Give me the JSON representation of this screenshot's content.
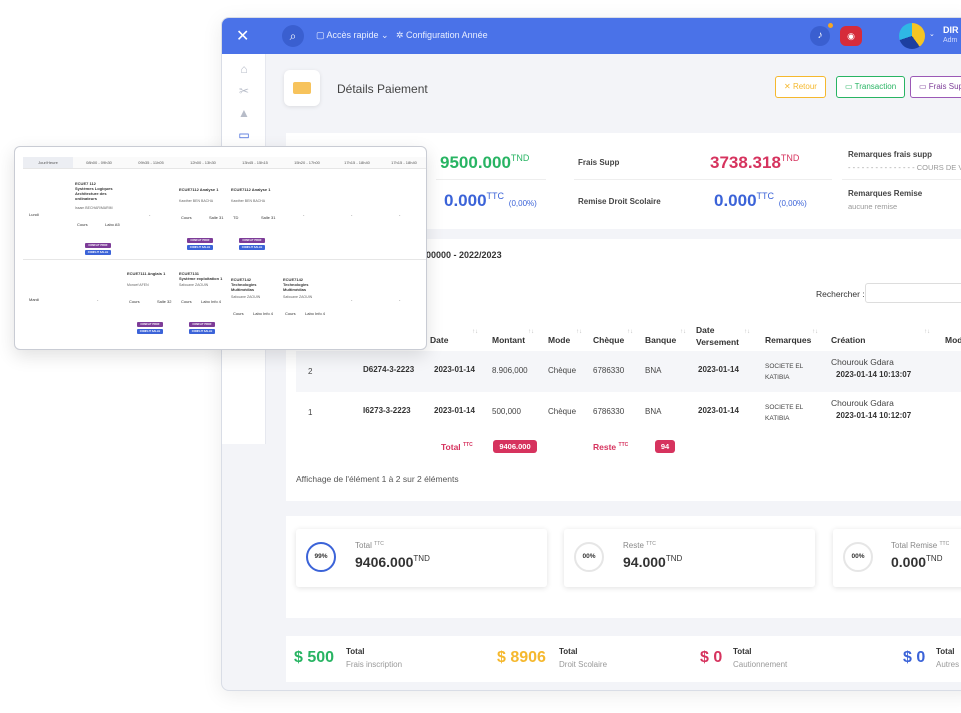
{
  "topbar": {
    "nav_quick": "Accès rapide",
    "nav_config": "Configuration Année",
    "user_name": "DIR",
    "user_role": "Adm"
  },
  "header": {
    "title": "Détails Paiement",
    "btn_retour": "Retour",
    "btn_transaction": "Transaction",
    "btn_frais": "Frais Sup"
  },
  "stats": {
    "main_value": "9500.000",
    "main_unit": "TND",
    "frais_supp_label": "Frais Supp",
    "frais_supp_value": "3738.318",
    "frais_supp_unit": "TND",
    "remarques_frais_label": "Remarques frais supp",
    "remarques_frais_value": "- - - - - - - - - - - - - - - COURS DE V",
    "remise_value": "0.000",
    "remise_unit": "TTC",
    "remise_pct": "(0,00%)",
    "remise_droit_label": "Remise Droit Scolaire",
    "remise_droit_value": "0.000",
    "remise_droit_unit": "TTC",
    "remise_droit_pct": "(0,00%)",
    "remarques_remise_label": "Remarques Remise",
    "remarques_remise_value": "aucune remise"
  },
  "section_title": "00000 - 2022/2023",
  "search_label": "Rechercher :",
  "table": {
    "headers": [
      "Date",
      "Montant",
      "Mode",
      "Chèque",
      "Banque",
      "Date Versement",
      "Remarques",
      "Création",
      "Mod"
    ],
    "rows": [
      {
        "num": "2",
        "ref": "D6274-3-2223",
        "date": "2023-01-14",
        "montant": "8.906,000",
        "mode": "Chèque",
        "cheque": "6786330",
        "banque": "BNA",
        "versement": "2023-01-14",
        "remarques": "SOCIETE EL KATIBIA",
        "creation_user": "Chourouk Gdara",
        "creation_date": "2023-01-14 10:13:07"
      },
      {
        "num": "1",
        "ref": "I6273-3-2223",
        "date": "2023-01-14",
        "montant": "500,000",
        "mode": "Chèque",
        "cheque": "6786330",
        "banque": "BNA",
        "versement": "2023-01-14",
        "remarques": "SOCIETE EL KATIBIA",
        "creation_user": "Chourouk Gdara",
        "creation_date": "2023-01-14 10:12:07"
      }
    ],
    "total_label": "Total",
    "total_sup": "TTC",
    "total_value": "9406.000",
    "reste_label": "Reste",
    "reste_sup": "TTC",
    "reste_value": "94",
    "info": "Affichage de l'élément 1 à 2 sur 2 éléments"
  },
  "summary": [
    {
      "pct": "99%",
      "label": "Total",
      "sup": "TTC",
      "value": "9406.000",
      "unit": "TND",
      "fraction": 0.99
    },
    {
      "pct": "00%",
      "label": "Reste",
      "sup": "TTC",
      "value": "94.000",
      "unit": "TND",
      "fraction": 0.0
    },
    {
      "pct": "00%",
      "label": "Total Remise",
      "sup": "TTC",
      "value": "0.000",
      "unit": "TND",
      "fraction": 0.0
    }
  ],
  "totals": [
    {
      "amount": "$ 500",
      "label": "Total",
      "sub": "Frais inscription",
      "color": "#28b463"
    },
    {
      "amount": "$ 8906",
      "label": "Total",
      "sub": "Droit Scolaire",
      "color": "#f5b82e"
    },
    {
      "amount": "$ 0",
      "label": "Total",
      "sub": "Cautionnement",
      "color": "#d6335e"
    },
    {
      "amount": "$ 0",
      "label": "Total",
      "sub": "Autres",
      "color": "#3b63d8"
    }
  ],
  "schedule": {
    "corner": "Jour/Heure",
    "slots": [
      "08h00 - 09h30",
      "09h35 - 11h05",
      "12h00 - 13h30",
      "13h45 - 15h15",
      "15h20 - 17h00",
      "17h15 - 18h40",
      "17h15 - 18h40"
    ],
    "days": [
      "Lundi",
      "Mardi"
    ],
    "dash": "-",
    "c1": {
      "code": "ECUE7 112",
      "title": "Systèmes Logiques Architecture des ordinateurs",
      "teacher": "Issam BECHAR/MARIM",
      "type": "Cours",
      "room": "Labo A5"
    },
    "c2": {
      "code": "ECUE7112 Analyse 1",
      "teacher": "Kawther BEN BACHA",
      "type": "Cours",
      "room": "Salle 31"
    },
    "c3": {
      "code": "ECUE7112 Analyse 1",
      "teacher": "Kawther BEN BACHA",
      "type": "TD",
      "room": "Salle 31"
    },
    "c4": {
      "code": "ECUE7111 Anglais 1",
      "teacher": "Moncef AFEN",
      "type": "Cours",
      "room": "Salle 32"
    },
    "c5": {
      "code": "ECUE7131",
      "title": "Système exploitation 1",
      "teacher": "Safouane ZAOUIN",
      "type": "Cours",
      "room": "Labo Info 4"
    },
    "c6": {
      "code": "ECUE7142",
      "title": "Technologies Multimédias",
      "teacher": "Safouane ZAOUIN",
      "type": "Cours",
      "room": "Labo Info 4"
    },
    "c7": {
      "code": "ECUE7142",
      "title": "Technologies Multimédias",
      "teacher": "Safouane ZAOUIN",
      "type": "Cours",
      "room": "Labo Info 4"
    },
    "chip_prof": "CONFLIT PROF",
    "chip_salle": "CONFLIT SALLE"
  },
  "colors": {
    "primary": "#4a72e8",
    "green": "#28b463",
    "red": "#d6335e",
    "blue": "#3b63d8",
    "orange": "#f5b82e"
  }
}
